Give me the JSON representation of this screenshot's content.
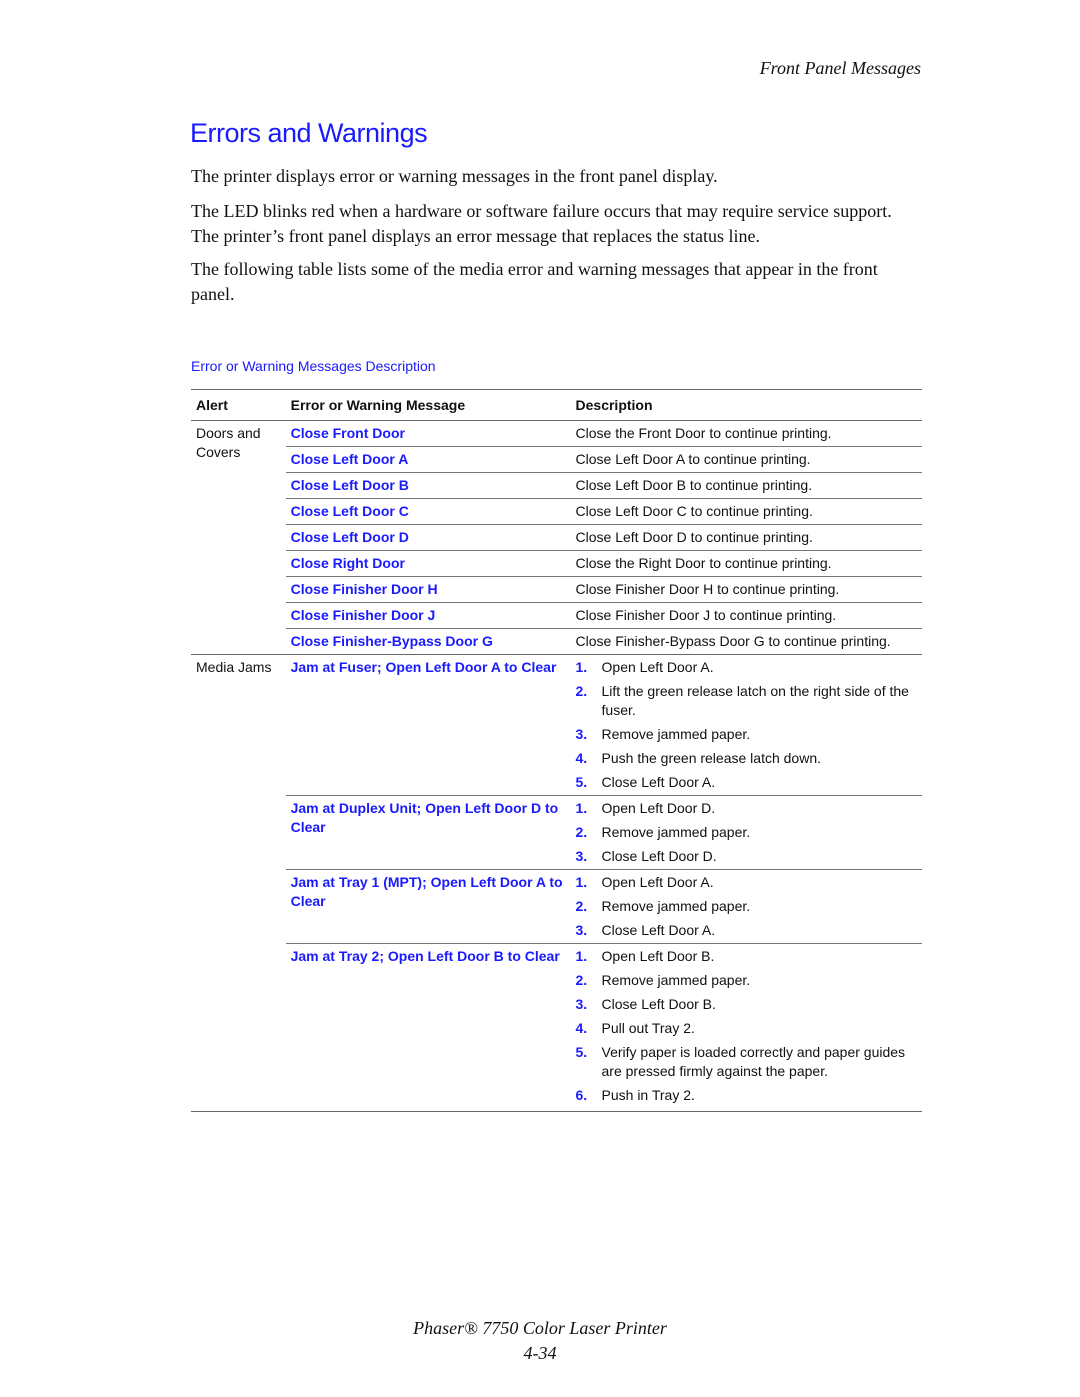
{
  "header": {
    "running_title": "Front Panel Messages"
  },
  "page_title": "Errors and Warnings",
  "paragraphs": [
    "The printer displays error or warning messages in the front panel display.",
    "The LED blinks red when a hardware or software failure occurs that may require service support. The printer’s front panel displays an error message that replaces the status line.",
    "The following table lists some of the media error and warning messages that appear in the front panel."
  ],
  "table": {
    "caption": "Error or Warning Messages Description",
    "columns": [
      "Alert",
      "Error or Warning Message",
      "Description"
    ],
    "groups": [
      {
        "alert": "Doors and Covers",
        "rows": [
          {
            "message": "Close Front Door",
            "description": "Close the Front Door to continue printing."
          },
          {
            "message": "Close Left Door A",
            "description": "Close Left Door A to continue printing."
          },
          {
            "message": "Close Left Door B",
            "description": "Close Left Door B to continue printing."
          },
          {
            "message": "Close Left Door C",
            "description": "Close Left Door C to continue printing."
          },
          {
            "message": "Close Left Door D",
            "description": "Close Left Door D to continue printing."
          },
          {
            "message": "Close Right Door",
            "description": "Close the Right Door to continue printing."
          },
          {
            "message": "Close Finisher Door H",
            "description": "Close Finisher Door H to continue printing."
          },
          {
            "message": "Close Finisher Door J",
            "description": "Close Finisher Door J to continue printing."
          },
          {
            "message": "Close Finisher-Bypass Door G",
            "description": "Close Finisher-Bypass Door G to continue printing."
          }
        ]
      },
      {
        "alert": "Media Jams",
        "rows": [
          {
            "message": "Jam at Fuser; Open Left Door A to Clear",
            "steps": [
              {
                "num": "1.",
                "text": "Open Left Door A."
              },
              {
                "num": "2.",
                "text": "Lift the green release latch on the right side of the fuser."
              },
              {
                "num": "3.",
                "text": "Remove jammed paper."
              },
              {
                "num": "4.",
                "text": "Push the green release latch down."
              },
              {
                "num": "5.",
                "text": "Close Left Door A."
              }
            ]
          },
          {
            "message": "Jam at Duplex Unit; Open Left Door D to Clear",
            "steps": [
              {
                "num": "1.",
                "text": "Open Left Door D."
              },
              {
                "num": "2.",
                "text": "Remove jammed paper."
              },
              {
                "num": "3.",
                "text": "Close Left Door D."
              }
            ]
          },
          {
            "message": "Jam at Tray 1 (MPT); Open Left Door A to Clear",
            "steps": [
              {
                "num": "1.",
                "text": "Open Left Door A."
              },
              {
                "num": "2.",
                "text": "Remove jammed paper."
              },
              {
                "num": "3.",
                "text": "Close Left Door A."
              }
            ]
          },
          {
            "message": "Jam at Tray 2; Open Left Door B to Clear",
            "steps": [
              {
                "num": "1.",
                "text": "Open Left Door B."
              },
              {
                "num": "2.",
                "text": "Remove jammed paper."
              },
              {
                "num": "3.",
                "text": "Close Left Door B."
              },
              {
                "num": "4.",
                "text": "Pull out Tray 2."
              },
              {
                "num": "5.",
                "text": "Verify paper is loaded correctly and paper guides are pressed firmly against the paper."
              },
              {
                "num": "6.",
                "text": "Push in Tray 2."
              }
            ]
          }
        ]
      }
    ]
  },
  "footer": {
    "product": "Phaser® 7750 Color Laser Printer",
    "page_number": "4-34"
  },
  "colors": {
    "accent_blue": "#1a1aff",
    "text": "#111111",
    "rule": "#666666"
  }
}
